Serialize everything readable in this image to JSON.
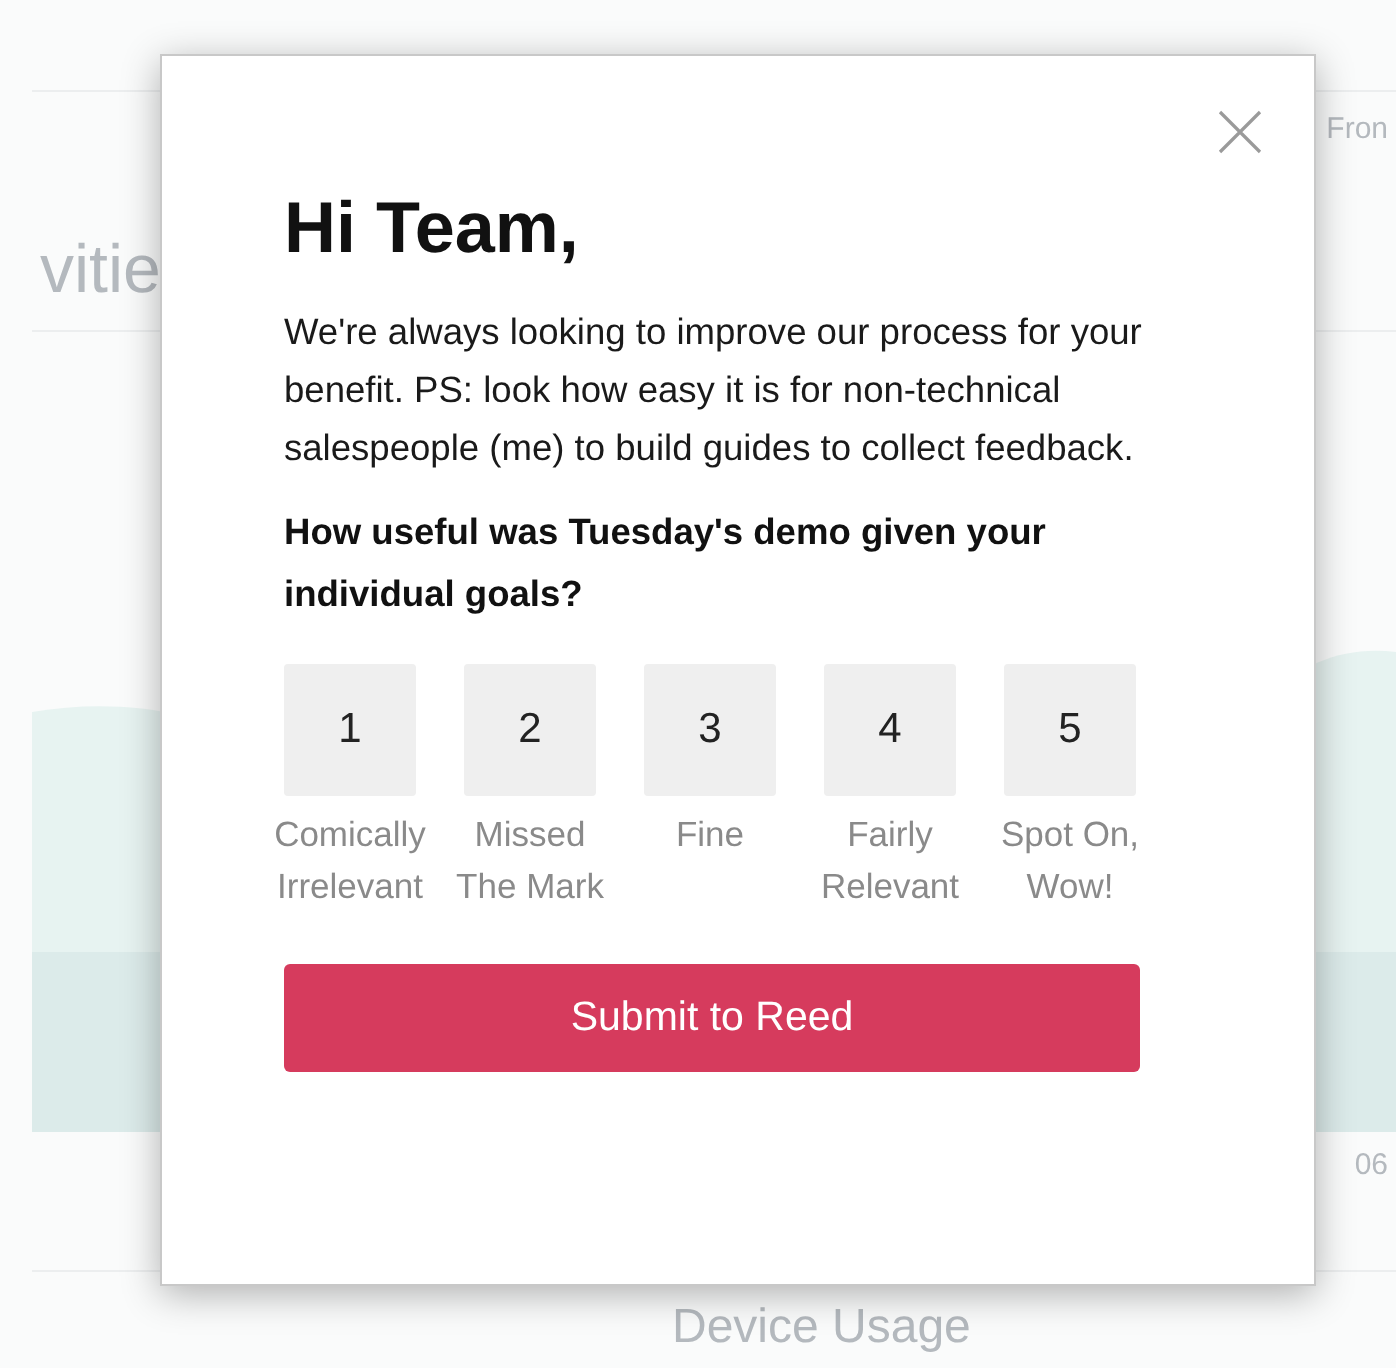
{
  "background": {
    "section_title": "vitie",
    "stat_caption": "Fron",
    "axis_label": "06",
    "panel_title": "Device Usage"
  },
  "modal": {
    "title": "Hi Team,",
    "message": "We're always looking to improve our process for your benefit. PS: look how easy it is for non-technical salespeople (me) to build guides to collect feedback.",
    "question": "How useful was Tuesday's demo given your individual goals?",
    "options": [
      {
        "number": "1",
        "label": "Comically Irrelevant"
      },
      {
        "number": "2",
        "label": "Missed The Mark"
      },
      {
        "number": "3",
        "label": "Fine"
      },
      {
        "number": "4",
        "label": "Fairly Relevant"
      },
      {
        "number": "5",
        "label": "Spot On, Wow!"
      }
    ],
    "submit": "Submit to Reed"
  }
}
